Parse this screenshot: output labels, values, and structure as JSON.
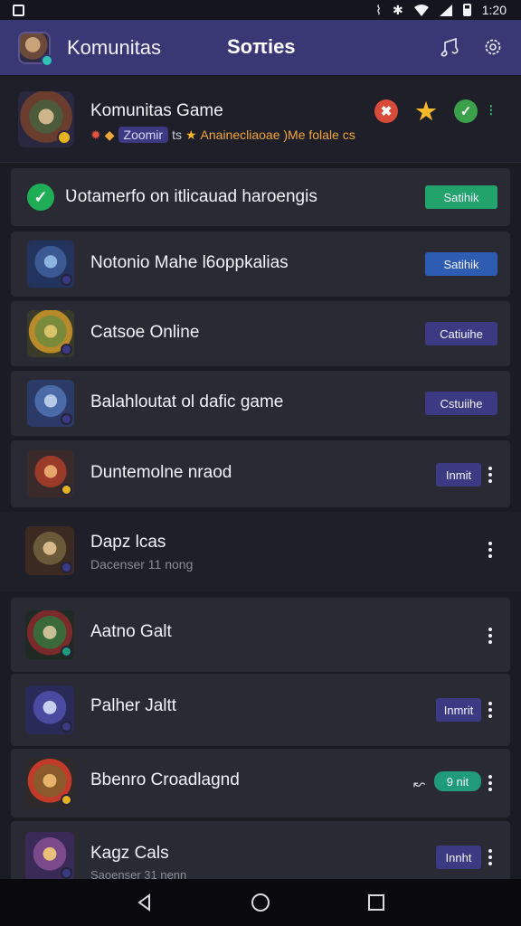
{
  "status_bar": {
    "time": "1:20",
    "icons": [
      "nfc-icon",
      "bluetooth-icon",
      "wifi-icon",
      "signal-icon",
      "battery-icon"
    ]
  },
  "app_bar": {
    "app_name": "Komunitas",
    "page_title": "Soπies",
    "actions": [
      "music-icon",
      "settings-icon"
    ]
  },
  "header": {
    "title": "Komunitas Game",
    "chip": "Zoomir",
    "chip_suffix": "ts",
    "subtitle_orange": "Anainecliaoae  )Me folale cs",
    "badges": [
      "fire-badge-icon",
      "star-badge-icon",
      "leaf-badge-icon"
    ]
  },
  "rows": [
    {
      "kind": "notice",
      "title": "Ʋotamerfo on itlicauad haroengis",
      "action": "Satihik",
      "action_style": "green"
    },
    {
      "title": "Notonio Mahe l6oppkalias",
      "action": "Satihik",
      "action_style": "blue"
    },
    {
      "title": "Catsoe Online",
      "action": "Catiuihe",
      "action_style": "purple"
    },
    {
      "title": "Balahloutat ol dafic game",
      "action": "Cstuiihe",
      "action_style": "purple"
    },
    {
      "title": "Duntemolne nraod",
      "action": "Inmit",
      "action_style": "purple"
    },
    {
      "title": "Dapz lcas",
      "subtitle": "Dacenser 11 nong"
    },
    {
      "title": "Aatno Galt"
    },
    {
      "title": "Palher Jaltt",
      "action": "Inmrit",
      "action_style": "purple"
    },
    {
      "title": "Bbenro Croadlagnd",
      "action": "9 nit",
      "action_style": "teal"
    },
    {
      "title": "Kagz Cals",
      "subtitle": "Saoenser 31 nenn",
      "action": "Innht",
      "action_style": "purple"
    }
  ],
  "nav": [
    "back-icon",
    "home-icon",
    "recents-icon"
  ],
  "colors": {
    "app_bar": "#3a3775",
    "background": "#1b1b24",
    "card": "#2a2a35",
    "green": "#22a36b",
    "blue": "#2f5cb3",
    "purple": "#3b3a82"
  }
}
